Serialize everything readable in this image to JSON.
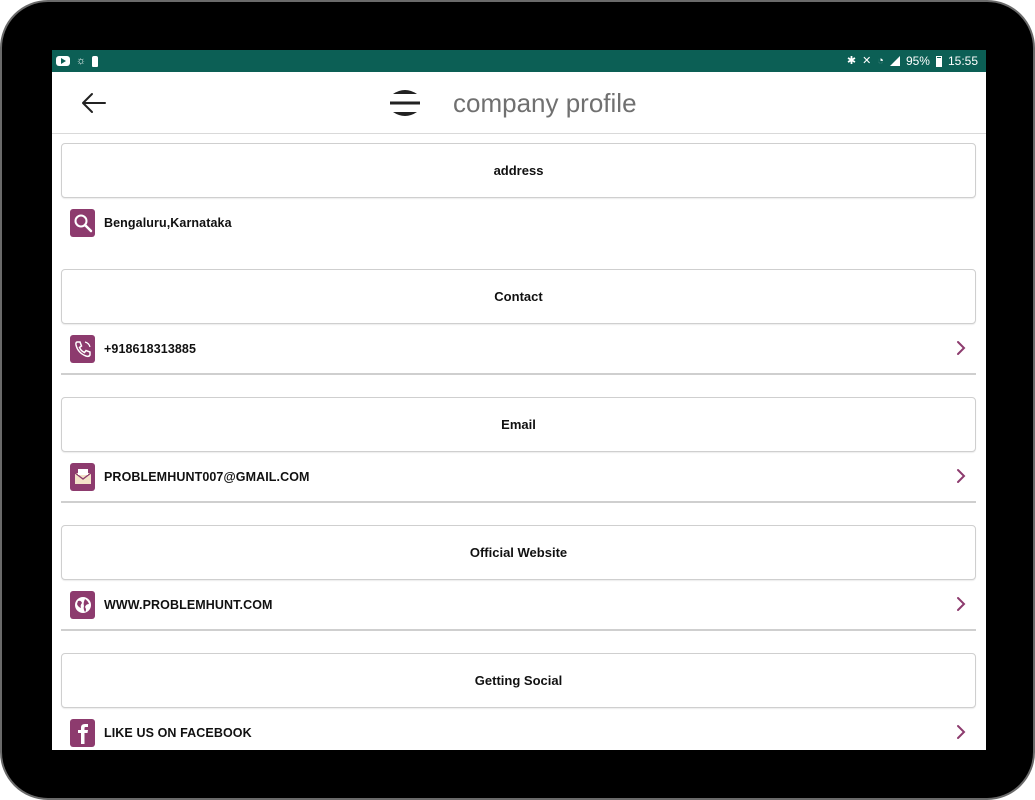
{
  "status_bar": {
    "battery": "95%",
    "time": "15:55",
    "left_icons": [
      "youtube-icon",
      "brightness-icon",
      "lock-icon"
    ],
    "right_icons": [
      "bluetooth-icon",
      "mute-icon",
      "wifi-icon",
      "signal-icon",
      "battery-icon"
    ]
  },
  "app_bar": {
    "title": "company profile",
    "back_icon": "arrow-left-icon",
    "logo_icon": "sphere-logo-icon"
  },
  "sections": [
    {
      "header": "address",
      "icon": "search-icon",
      "value": "Bengaluru,Karnataka",
      "has_chevron": false
    },
    {
      "header": "Contact",
      "icon": "phone-icon",
      "value": "+918618313885",
      "has_chevron": true
    },
    {
      "header": "Email",
      "icon": "mail-icon",
      "value": "PROBLEMHUNT007@GMAIL.COM",
      "has_chevron": true
    },
    {
      "header": "Official Website",
      "icon": "globe-icon",
      "value": "WWW.PROBLEMHUNT.COM",
      "has_chevron": true
    },
    {
      "header": "Getting Social",
      "icon": "facebook-icon",
      "value": "LIKE US ON FACEBOOK",
      "has_chevron": true
    }
  ],
  "colors": {
    "status_bar": "#0c5f55",
    "icon_bg": "#8d3b6e",
    "chevron": "#8d3b6e",
    "title": "#707070"
  }
}
